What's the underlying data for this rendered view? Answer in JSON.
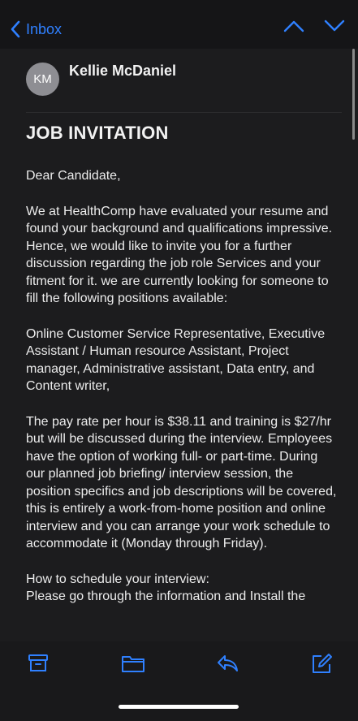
{
  "nav": {
    "back_label": "Inbox",
    "accent_color": "#2f80ff"
  },
  "message": {
    "sender_initials": "KM",
    "sender_name": "Kellie McDaniel",
    "subject": "JOB INVITATION",
    "paragraphs": [
      "Dear Candidate,",
      "We at HealthComp have evaluated your resume and found your background and qualifications impressive. Hence, we would like to invite you for a further discussion regarding the job role Services and your fitment for it. we are currently looking for someone to fill the following positions available:",
      "Online Customer Service Representative, Executive Assistant / Human resource Assistant, Project manager, Administrative assistant, Data entry, and Content writer,",
      "The pay rate per hour is $38.11 and training is $27/hr but will be discussed during the interview. Employees have the option of working full- or part-time. During our planned job briefing/ interview session, the position specifics and job descriptions will be covered,  this is entirely a work-from-home position and online interview and you can arrange your work schedule to accommodate it (Monday through Friday).",
      "How to schedule your interview:\nPlease go through the information and Install the"
    ]
  },
  "toolbar": {
    "icons": [
      "archive-icon",
      "folder-icon",
      "reply-icon",
      "compose-icon"
    ]
  }
}
